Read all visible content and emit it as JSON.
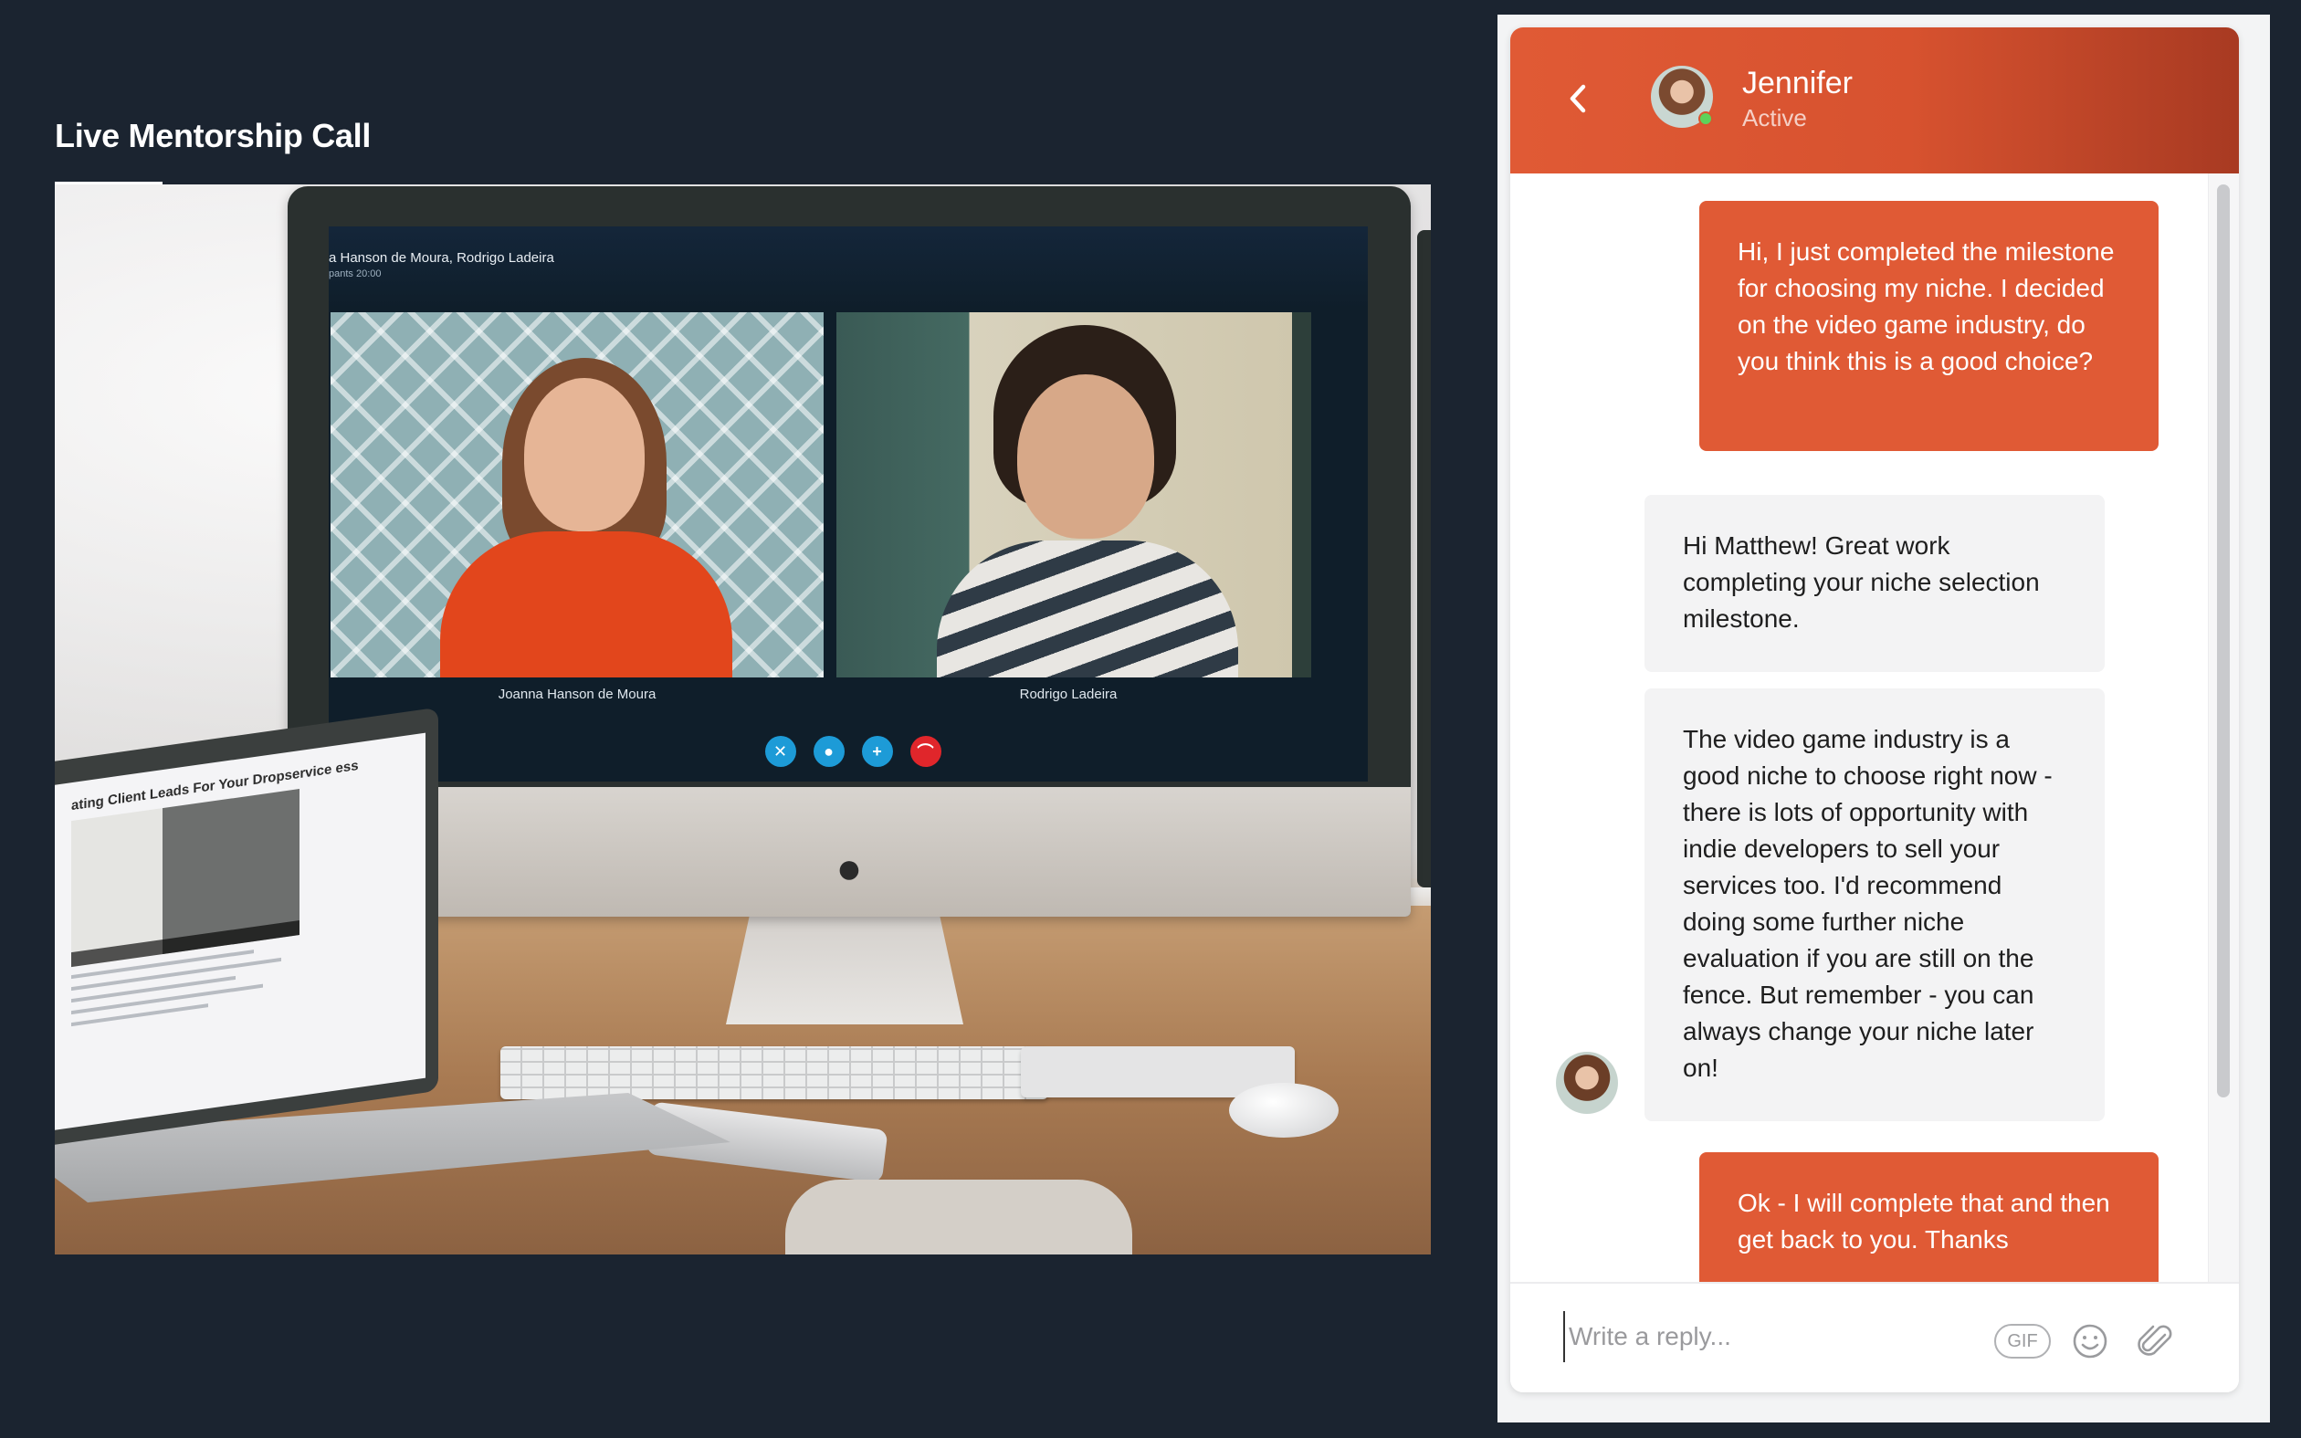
{
  "page": {
    "title": "Live Mentorship Call"
  },
  "video_call": {
    "participants_text": "a Hanson de Moura, Rodrigo Ladeira",
    "timer_text": "pants   20:00",
    "participants": [
      {
        "name": "Joanna Hanson de Moura"
      },
      {
        "name": "Rodrigo Ladeira"
      }
    ],
    "controls": [
      {
        "icon": "video-off-icon",
        "glyph": "✕"
      },
      {
        "icon": "microphone-icon",
        "glyph": "●"
      },
      {
        "icon": "add-icon",
        "glyph": "+"
      },
      {
        "icon": "hang-up-icon",
        "glyph": "⌒"
      }
    ],
    "laptop_lesson_title": "ating Client Leads For Your Dropservice ess"
  },
  "chat": {
    "contact": {
      "name": "Jennifer",
      "status": "Active"
    },
    "messages": [
      {
        "direction": "out",
        "text": "Hi, I just completed the milestone for choosing my niche. I decided on the video game industry, do you think this is a good choice?"
      },
      {
        "direction": "in",
        "text": "Hi Matthew! Great work completing your niche selection milestone."
      },
      {
        "direction": "in",
        "text": "The video game industry is a good niche to choose right now - there is lots of opportunity with indie developers to sell your services too. I'd recommend doing some further niche evaluation if you are still on the fence. But remember - you can always change your niche later on!"
      },
      {
        "direction": "out",
        "text": "Ok - I will complete that and then get back to you. Thanks"
      }
    ],
    "composer": {
      "placeholder": "Write a reply...",
      "gif_label": "GIF"
    },
    "colors": {
      "accent": "#e05a35",
      "header_dark": "#a83a22",
      "incoming_bubble": "#f3f3f4",
      "online": "#5ed35a"
    }
  }
}
